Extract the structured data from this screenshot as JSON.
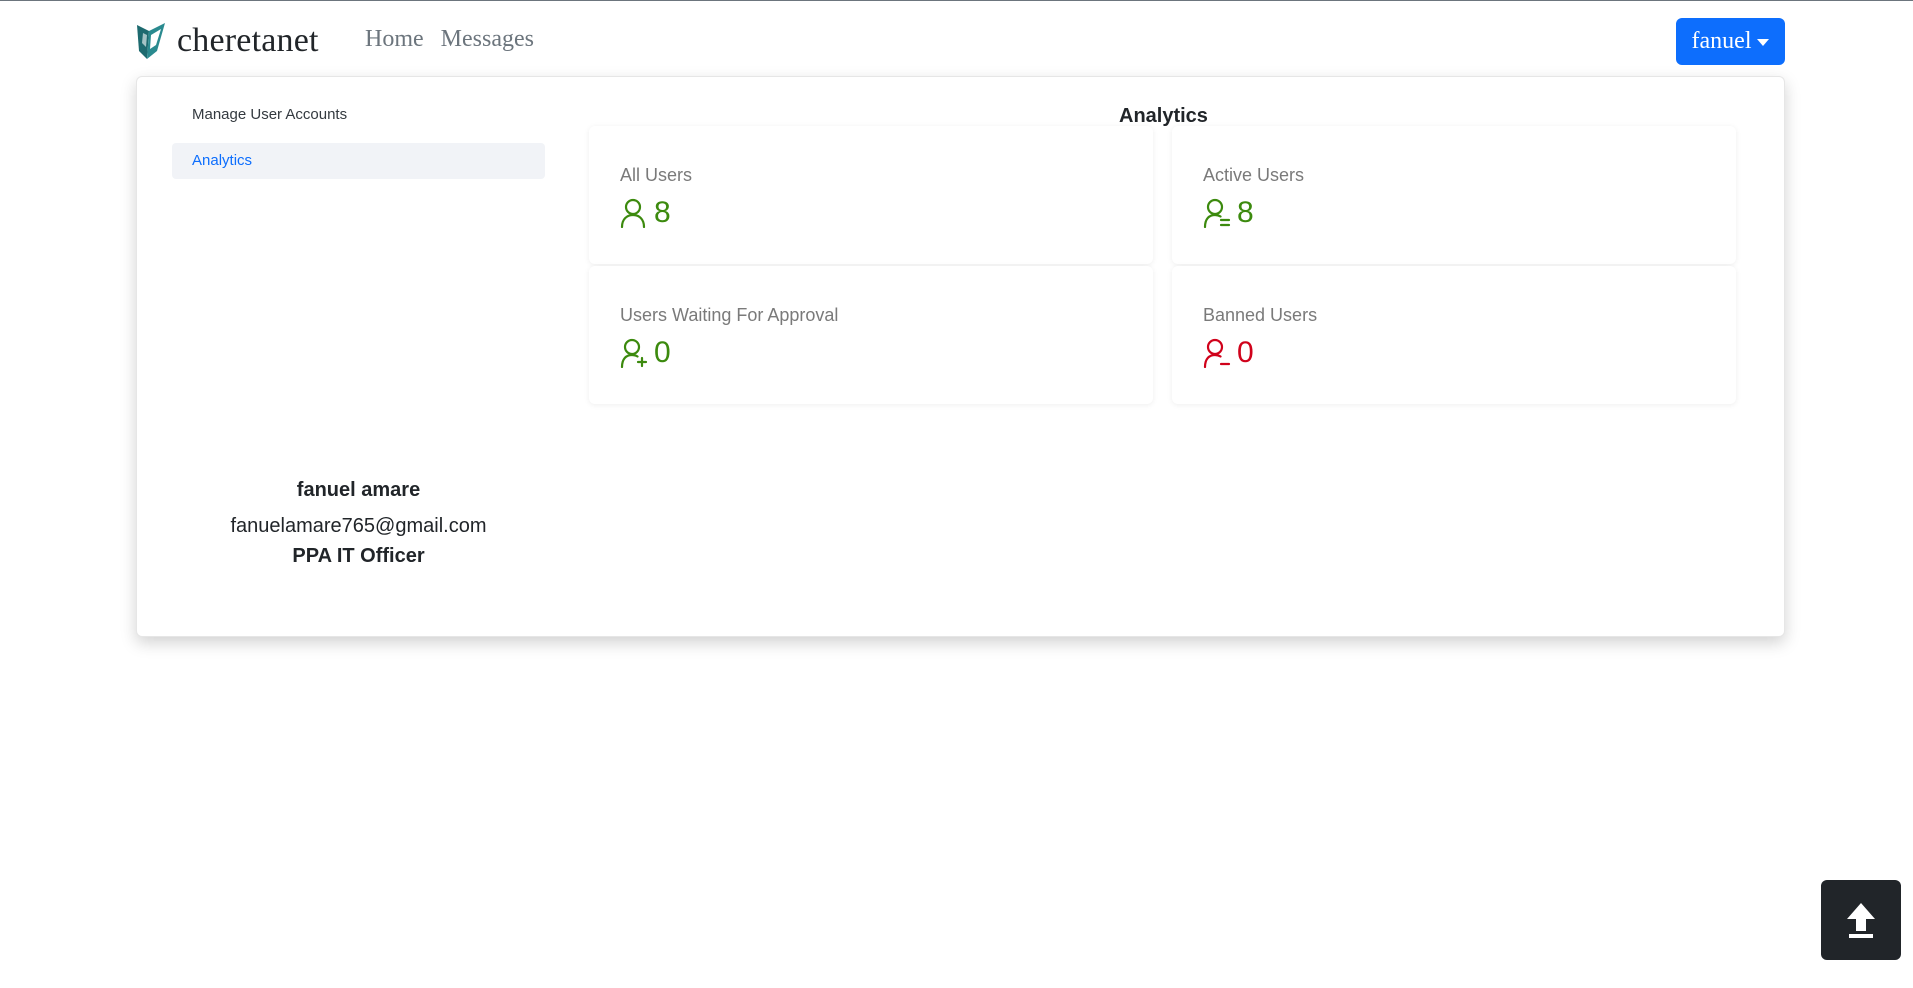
{
  "navbar": {
    "brand_name": "cheretanet",
    "links": [
      {
        "label": "Home"
      },
      {
        "label": "Messages"
      }
    ],
    "user_button_label": "fanuel"
  },
  "sidebar": {
    "items": [
      {
        "label": "Manage User Accounts",
        "active": false
      },
      {
        "label": "Analytics",
        "active": true
      }
    ]
  },
  "profile": {
    "name": "fanuel amare",
    "email": "fanuelamare765@gmail.com",
    "role": "PPA IT Officer"
  },
  "analytics": {
    "title": "Analytics",
    "cards": [
      {
        "label": "All Users",
        "value": "8",
        "icon": "user-icon",
        "color": "#3c8a0e"
      },
      {
        "label": "Active Users",
        "value": "8",
        "icon": "user-check-icon",
        "color": "#3c8a0e"
      },
      {
        "label": "Users Waiting For Approval",
        "value": "0",
        "icon": "user-plus-icon",
        "color": "#3c8a0e"
      },
      {
        "label": "Banned Users",
        "value": "0",
        "icon": "user-minus-icon",
        "color": "#d0021b"
      }
    ]
  },
  "colors": {
    "primary": "#0d6efd",
    "success": "#3c8a0e",
    "danger": "#d0021b",
    "dark": "#212529"
  },
  "scroll_top": {
    "icon": "arrow-up-icon"
  }
}
